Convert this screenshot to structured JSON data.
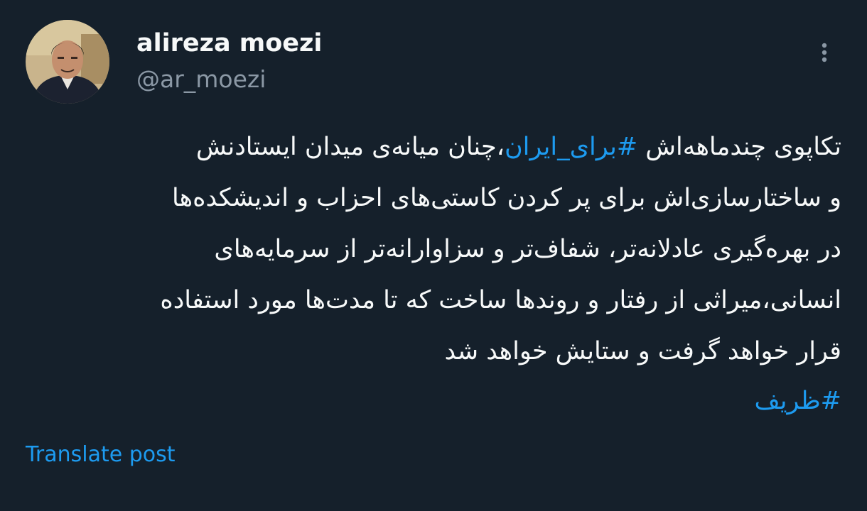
{
  "user": {
    "display_name": "alireza moezi",
    "handle": "@ar_moezi"
  },
  "tweet": {
    "line1": {
      "before": "تکاپوی چندماهه‌اش ",
      "hashtag": "#برای_ایران",
      "after": "،چنان میانه‌ی میدان ایستادنش"
    },
    "line2": "و ساختارسازی‌اش برای پر کردن کاستی‌های احزاب و اندیشکده‌ها",
    "line3": "در بهره‌گیری عادلانه‌تر، شفاف‌تر و سزاوارانه‌تر از سرمایه‌های",
    "line4": "انسانی،میراثی از رفتار و روندها ساخت که تا مدت‌ها مورد استفاده",
    "line5": "قرار خواهد گرفت و ستایش خواهد شد",
    "hashtag2": "#ظریف"
  },
  "translate_label": "Translate post",
  "icons": {
    "more": "more-vertical-icon"
  },
  "colors": {
    "background": "#15202b",
    "text": "#f7f9f9",
    "secondary_text": "#8b98a5",
    "link": "#1d9bf0"
  }
}
